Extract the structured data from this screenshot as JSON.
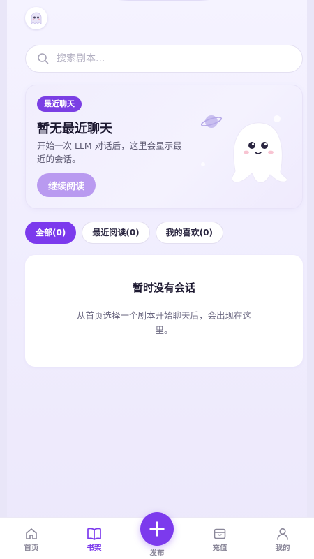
{
  "header": {
    "avatar_icon": "ghost-avatar-icon"
  },
  "search": {
    "placeholder": "搜索剧本...",
    "icon": "search-icon"
  },
  "hero": {
    "badge": "最近聊天",
    "title": "暂无最近聊天",
    "description": "开始一次 LLM 对话后，这里会显示最近的会话。",
    "button_label": "继续阅读",
    "illustration": "ghost-illustration"
  },
  "tabs": [
    {
      "label": "全部(0)",
      "active": true
    },
    {
      "label": "最近阅读(0)",
      "active": false
    },
    {
      "label": "我的喜欢(0)",
      "active": false
    }
  ],
  "empty_state": {
    "title": "暂时没有会话",
    "description": "从首页选择一个剧本开始聊天后，会出现在这里。"
  },
  "bottom_nav": {
    "items": [
      {
        "label": "首页",
        "icon": "home-icon",
        "active": false
      },
      {
        "label": "书架",
        "icon": "book-icon",
        "active": true
      },
      {
        "label": "发布",
        "icon": "plus-icon",
        "active": false
      },
      {
        "label": "充值",
        "icon": "wallet-icon",
        "active": false
      },
      {
        "label": "我的",
        "icon": "user-icon",
        "active": false
      }
    ]
  },
  "colors": {
    "accent": "#7c3aed",
    "badge": "#7b3fe4",
    "button_muted": "#b99af0",
    "background": "#f3f0fe"
  }
}
